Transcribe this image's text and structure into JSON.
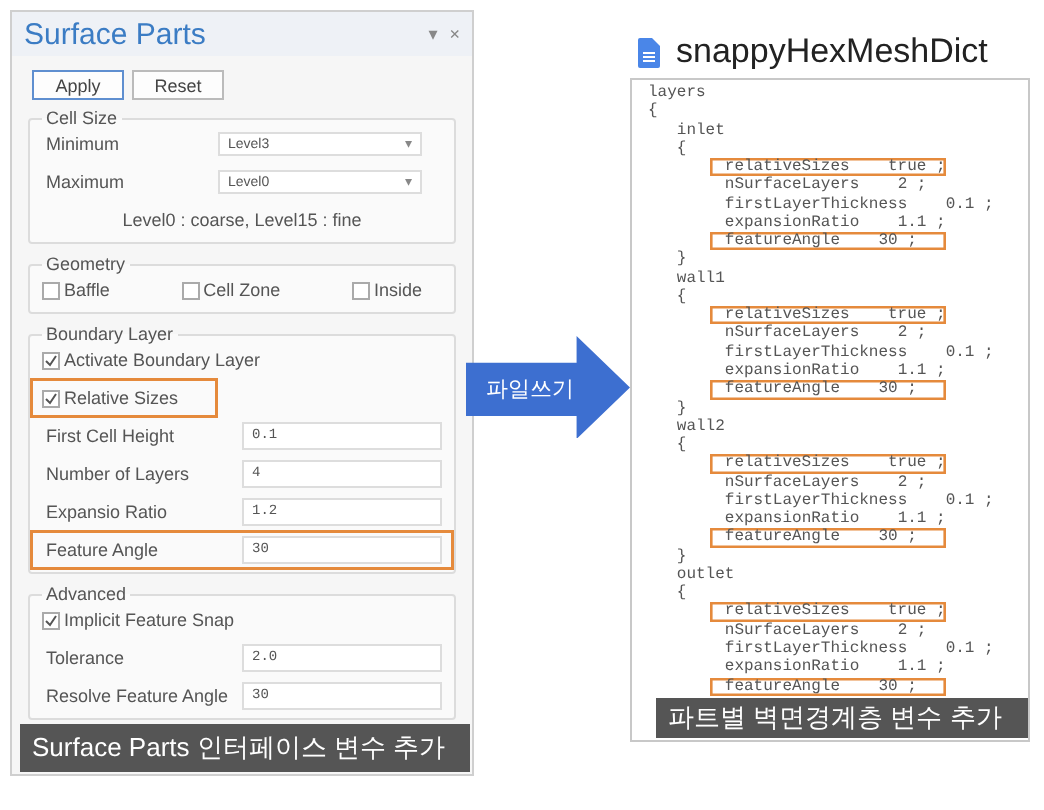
{
  "panel": {
    "title": "Surface Parts",
    "menu_glyph": "▾",
    "close_glyph": "×",
    "buttons": [
      {
        "label": "Apply",
        "default": true
      },
      {
        "label": "Reset",
        "default": false
      }
    ],
    "groups": [
      {
        "title": "Cell Size",
        "kind": "form",
        "items": [
          {
            "kind": "select",
            "label": "Minimum",
            "value": "Level3",
            "arrow": "▾"
          },
          {
            "kind": "select",
            "label": "Maximum",
            "value": "Level0",
            "arrow": "▾"
          },
          {
            "kind": "hint",
            "label": "Level0 : coarse, Level15 : fine"
          }
        ]
      },
      {
        "title": "Geometry",
        "kind": "options",
        "items": [
          {
            "kind": "checkbox",
            "label": "Baffle",
            "checked": false,
            "highlighted": false
          },
          {
            "kind": "checkbox",
            "label": "Cell Zone",
            "checked": false,
            "highlighted": false
          },
          {
            "kind": "checkbox",
            "label": "Inside",
            "checked": false,
            "highlighted": false
          }
        ]
      },
      {
        "title": "Boundary Layer",
        "kind": "form",
        "items": [
          {
            "kind": "checkbox",
            "label": "Activate Boundary Layer",
            "checked": true,
            "highlighted": false
          },
          {
            "kind": "checkbox",
            "label": "Relative Sizes",
            "checked": true,
            "highlighted": true
          },
          {
            "kind": "field",
            "label": "First Cell Height",
            "value": "0.1",
            "highlighted": false
          },
          {
            "kind": "field",
            "label": "Number of Layers",
            "value": "4",
            "highlighted": false
          },
          {
            "kind": "field",
            "label": "Expansio Ratio",
            "value": "1.2",
            "highlighted": false
          },
          {
            "kind": "field",
            "label": "Feature Angle",
            "value": "30",
            "highlighted": true
          }
        ]
      },
      {
        "title": "Advanced",
        "kind": "form",
        "items": [
          {
            "kind": "checkbox",
            "label": "Implicit Feature Snap",
            "checked": true,
            "highlighted": false
          },
          {
            "kind": "field",
            "label": "Tolerance",
            "value": "2.0",
            "highlighted": false
          },
          {
            "kind": "field",
            "label": "Resolve Feature Angle",
            "value": "30",
            "highlighted": false
          }
        ]
      }
    ],
    "caption": "Surface Parts 인터페이스 변수 추가"
  },
  "arrow": {
    "label": "파일쓰기"
  },
  "file": {
    "title": "snappyHexMeshDict",
    "lines": [
      {
        "text": "layers",
        "highlighted": false
      },
      {
        "text": "{",
        "highlighted": false
      },
      {
        "text": "   inlet",
        "highlighted": false
      },
      {
        "text": "   {",
        "highlighted": false
      },
      {
        "text": "relativeSizes    true ;",
        "highlighted": true
      },
      {
        "text": "        nSurfaceLayers    2 ;",
        "highlighted": false
      },
      {
        "text": "        firstLayerThickness    0.1 ;",
        "highlighted": false
      },
      {
        "text": "        expansionRatio    1.1 ;",
        "highlighted": false
      },
      {
        "text": "featureAngle    30 ;",
        "highlighted": true
      },
      {
        "text": "   }",
        "highlighted": false
      },
      {
        "text": "   wall1",
        "highlighted": false
      },
      {
        "text": "   {",
        "highlighted": false
      },
      {
        "text": "relativeSizes    true ;",
        "highlighted": true
      },
      {
        "text": "        nSurfaceLayers    2 ;",
        "highlighted": false
      },
      {
        "text": "        firstLayerThickness    0.1 ;",
        "highlighted": false
      },
      {
        "text": "        expansionRatio    1.1 ;",
        "highlighted": false
      },
      {
        "text": "featureAngle    30 ;",
        "highlighted": true
      },
      {
        "text": "   }",
        "highlighted": false
      },
      {
        "text": "   wall2",
        "highlighted": false
      },
      {
        "text": "   {",
        "highlighted": false
      },
      {
        "text": "relativeSizes    true ;",
        "highlighted": true
      },
      {
        "text": "        nSurfaceLayers    2 ;",
        "highlighted": false
      },
      {
        "text": "        firstLayerThickness    0.1 ;",
        "highlighted": false
      },
      {
        "text": "        expansionRatio    1.1 ;",
        "highlighted": false
      },
      {
        "text": "featureAngle    30 ;",
        "highlighted": true
      },
      {
        "text": "   }",
        "highlighted": false
      },
      {
        "text": "   outlet",
        "highlighted": false
      },
      {
        "text": "   {",
        "highlighted": false
      },
      {
        "text": "relativeSizes    true ;",
        "highlighted": true
      },
      {
        "text": "        nSurfaceLayers    2 ;",
        "highlighted": false
      },
      {
        "text": "        firstLayerThickness    0.1 ;",
        "highlighted": false
      },
      {
        "text": "        expansionRatio    1.1 ;",
        "highlighted": false
      },
      {
        "text": "featureAngle    30 ;",
        "highlighted": true
      }
    ],
    "caption": "파트별 벽면경계층 변수 추가"
  }
}
